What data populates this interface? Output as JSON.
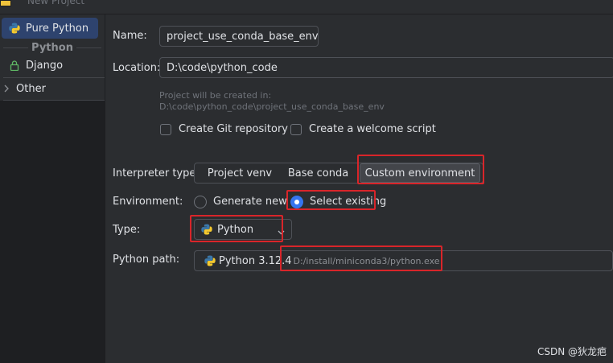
{
  "window": {
    "title": "New Project"
  },
  "sidebar": {
    "items": [
      {
        "label": "Pure Python",
        "icon": "python-icon",
        "selected": true
      },
      {
        "label": "Django",
        "icon": "lock-icon"
      },
      {
        "label": "Other",
        "icon": "chevron-right-icon"
      }
    ],
    "group_label": "Python"
  },
  "form": {
    "name_label": "Name:",
    "name_value": "project_use_conda_base_env",
    "location_label": "Location:",
    "location_value": "D:\\code\\python_code",
    "hint_line1": "Project will be created in:",
    "hint_line2": "D:\\code\\python_code\\project_use_conda_base_env",
    "git_label": "Create Git repository",
    "welcome_label": "Create a welcome script",
    "interpreter_label": "Interpreter type:",
    "interpreter_options": [
      "Project venv",
      "Base conda",
      "Custom environment"
    ],
    "interpreter_selected": "Custom environment",
    "environment_label": "Environment:",
    "env_generate": "Generate new",
    "env_select": "Select existing",
    "type_label": "Type:",
    "type_value": "Python",
    "python_path_label": "Python path:",
    "python_version": "Python 3.12.4",
    "python_path": "D:/install/miniconda3/python.exe"
  },
  "watermark": "CSDN @狄龙疤",
  "colors": {
    "accent": "#3574f0",
    "annotation": "#d9252a",
    "selected_bg": "#2e436e"
  }
}
